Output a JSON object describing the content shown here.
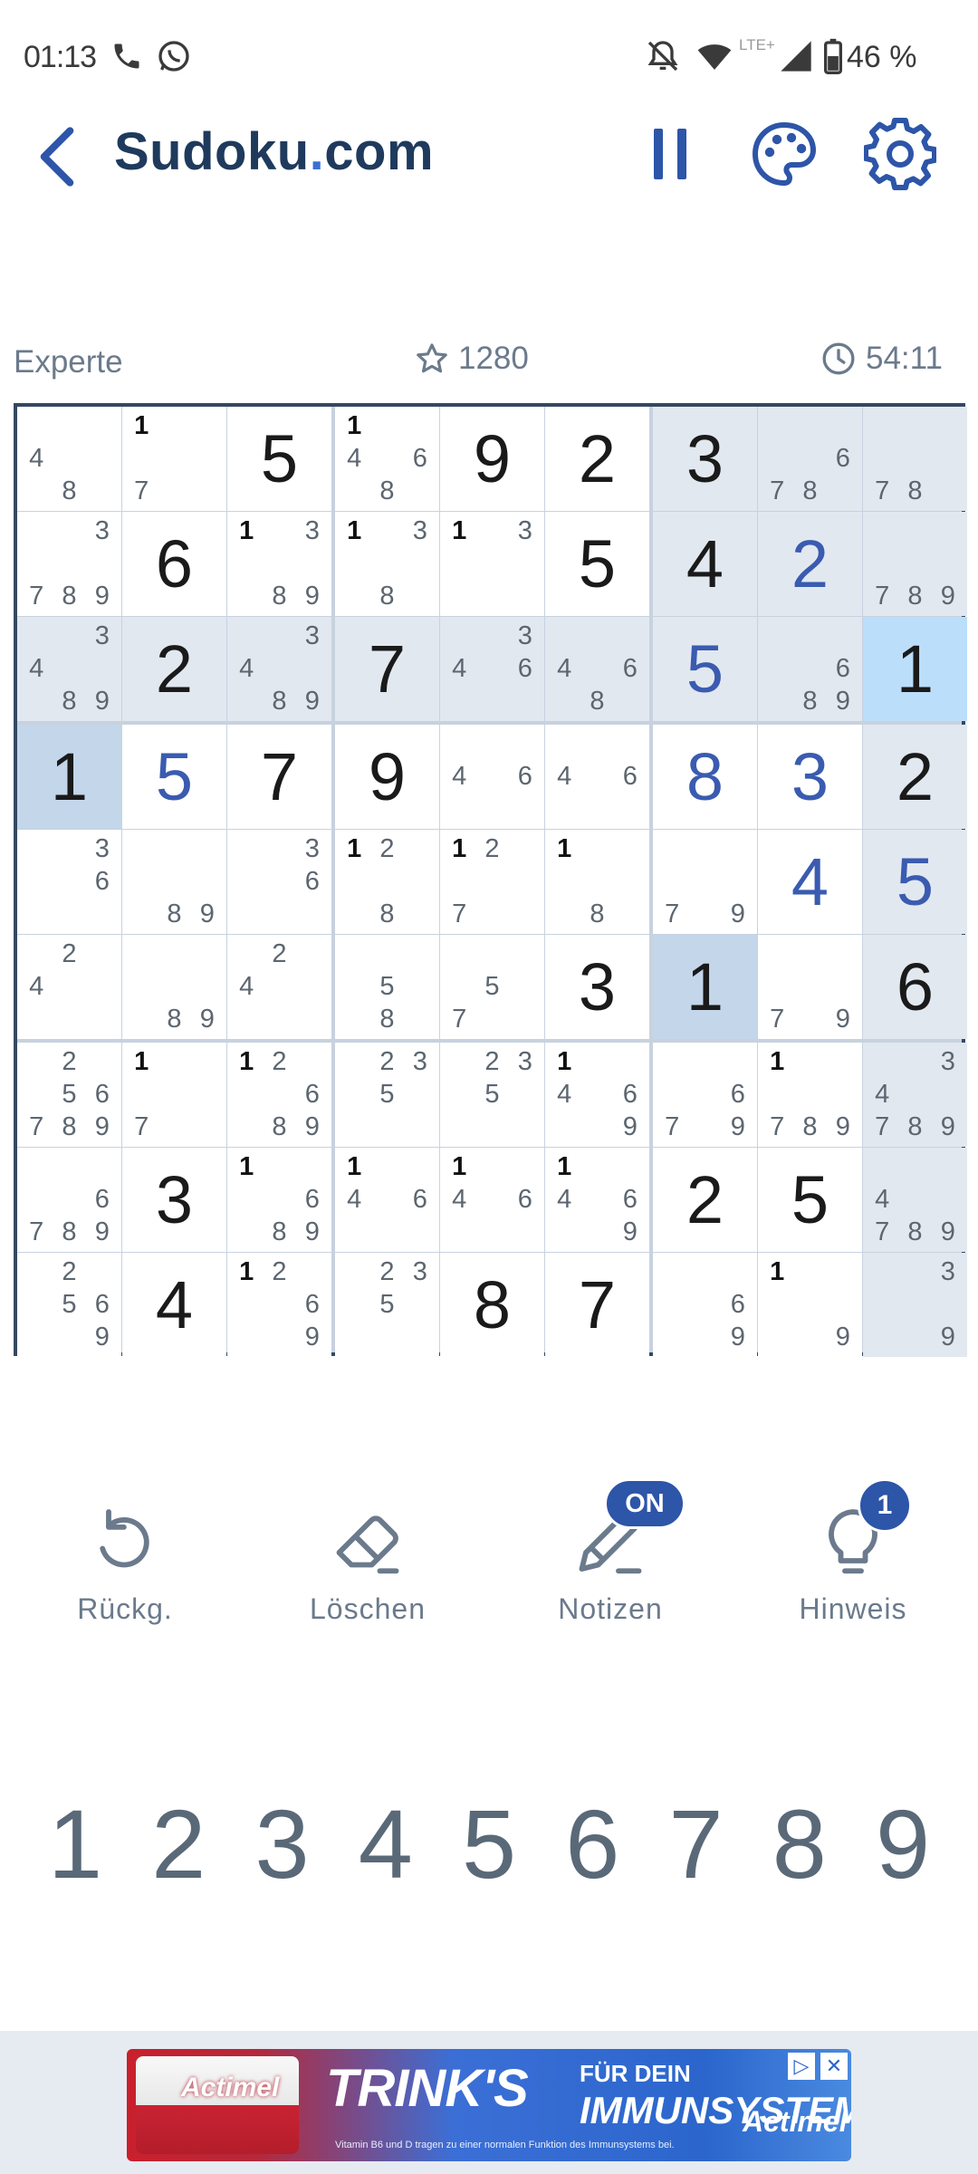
{
  "status_bar": {
    "time": "01:13",
    "battery": "46 %",
    "network": "LTE+"
  },
  "header": {
    "title_main": "Sudoku",
    "title_dot": ".",
    "title_tld": "com"
  },
  "info": {
    "level": "Experte",
    "score": "1280",
    "timer": "54:11"
  },
  "board": {
    "cells": [
      {
        "notes": [
          4,
          8
        ]
      },
      {
        "notes": [
          1,
          7
        ]
      },
      {
        "value": 5
      },
      {
        "notes": [
          1,
          4,
          6,
          8
        ]
      },
      {
        "value": 9
      },
      {
        "value": 2
      },
      {
        "value": 3
      },
      {
        "notes": [
          6,
          7,
          8
        ]
      },
      {
        "notes": [
          7,
          8
        ]
      },
      {
        "notes": [
          3,
          7,
          8,
          9
        ]
      },
      {
        "value": 6
      },
      {
        "notes": [
          1,
          3,
          8,
          9
        ]
      },
      {
        "notes": [
          1,
          3,
          8
        ]
      },
      {
        "notes": [
          1,
          3
        ]
      },
      {
        "value": 5
      },
      {
        "value": 4
      },
      {
        "value": 2,
        "user": true
      },
      {
        "notes": [
          7,
          8,
          9
        ]
      },
      {
        "notes": [
          3,
          4,
          8,
          9
        ]
      },
      {
        "value": 2
      },
      {
        "notes": [
          3,
          4,
          8,
          9
        ]
      },
      {
        "value": 7
      },
      {
        "notes": [
          3,
          4,
          6
        ]
      },
      {
        "notes": [
          4,
          6,
          8
        ]
      },
      {
        "value": 5,
        "user": true
      },
      {
        "notes": [
          6,
          8,
          9
        ]
      },
      {
        "value": 1
      },
      {
        "value": 1
      },
      {
        "value": 5,
        "user": true
      },
      {
        "value": 7
      },
      {
        "value": 9
      },
      {
        "notes": [
          4,
          6
        ]
      },
      {
        "notes": [
          4,
          6
        ]
      },
      {
        "value": 8,
        "user": true
      },
      {
        "value": 3,
        "user": true
      },
      {
        "value": 2
      },
      {
        "notes": [
          3,
          6
        ]
      },
      {
        "notes": [
          8,
          9
        ]
      },
      {
        "notes": [
          3,
          6
        ]
      },
      {
        "notes": [
          1,
          2,
          8
        ]
      },
      {
        "notes": [
          1,
          2,
          7
        ]
      },
      {
        "notes": [
          1,
          8
        ]
      },
      {
        "notes": [
          7,
          9
        ]
      },
      {
        "value": 4,
        "user": true
      },
      {
        "value": 5,
        "user": true
      },
      {
        "notes": [
          2,
          4
        ]
      },
      {
        "notes": [
          8,
          9
        ]
      },
      {
        "notes": [
          2,
          4
        ]
      },
      {
        "notes": [
          5,
          8
        ]
      },
      {
        "notes": [
          5,
          7
        ]
      },
      {
        "value": 3
      },
      {
        "value": 1
      },
      {
        "notes": [
          7,
          9
        ]
      },
      {
        "value": 6
      },
      {
        "notes": [
          2,
          5,
          6,
          7,
          8,
          9
        ]
      },
      {
        "notes": [
          1,
          7
        ]
      },
      {
        "notes": [
          1,
          2,
          6,
          8,
          9
        ]
      },
      {
        "notes": [
          2,
          3,
          5
        ]
      },
      {
        "notes": [
          2,
          3,
          5
        ]
      },
      {
        "notes": [
          1,
          4,
          6,
          9
        ]
      },
      {
        "notes": [
          6,
          7,
          9
        ]
      },
      {
        "notes": [
          1,
          7,
          8,
          9
        ]
      },
      {
        "notes": [
          3,
          4,
          7,
          8,
          9
        ]
      },
      {
        "notes": [
          6,
          7,
          8,
          9
        ]
      },
      {
        "value": 3
      },
      {
        "notes": [
          1,
          6,
          8,
          9
        ]
      },
      {
        "notes": [
          1,
          4,
          6
        ]
      },
      {
        "notes": [
          1,
          4,
          6
        ]
      },
      {
        "notes": [
          1,
          4,
          6,
          9
        ]
      },
      {
        "value": 2
      },
      {
        "value": 5
      },
      {
        "notes": [
          4,
          7,
          8,
          9
        ]
      },
      {
        "notes": [
          2,
          5,
          6,
          9
        ]
      },
      {
        "value": 4
      },
      {
        "notes": [
          1,
          2,
          6,
          9
        ]
      },
      {
        "notes": [
          2,
          3,
          5
        ]
      },
      {
        "value": 8
      },
      {
        "value": 7
      },
      {
        "notes": [
          6,
          9
        ]
      },
      {
        "notes": [
          1,
          9
        ]
      },
      {
        "notes": [
          3,
          9
        ]
      }
    ],
    "selected_cell": {
      "row": 3,
      "col": 9
    },
    "same_number_cells": [
      [
        4,
        1
      ],
      [
        6,
        7
      ]
    ]
  },
  "tools": [
    {
      "label": "Rückg.",
      "icon": "undo-icon"
    },
    {
      "label": "Löschen",
      "icon": "eraser-icon"
    },
    {
      "label": "Notizen",
      "icon": "pencil-icon",
      "badge": "ON"
    },
    {
      "label": "Hinweis",
      "icon": "lightbulb-icon",
      "badge": "1"
    }
  ],
  "numpad": [
    "1",
    "2",
    "3",
    "4",
    "5",
    "6",
    "7",
    "8",
    "9"
  ],
  "ad": {
    "brand": "Actimel",
    "headline": "TRINK'S",
    "subline1": "FÜR DEIN",
    "subline2": "IMMUNSYSTEM",
    "fineprint": "Vitamin B6 und D tragen zu einer normalen Funktion des Immunsystems bei."
  },
  "colors": {
    "accent": "#2d55a8",
    "title": "#1f3a5c",
    "user_digit": "#3a5bb0",
    "selected": "#bbdefb",
    "highlight": "#e2e8f0"
  }
}
